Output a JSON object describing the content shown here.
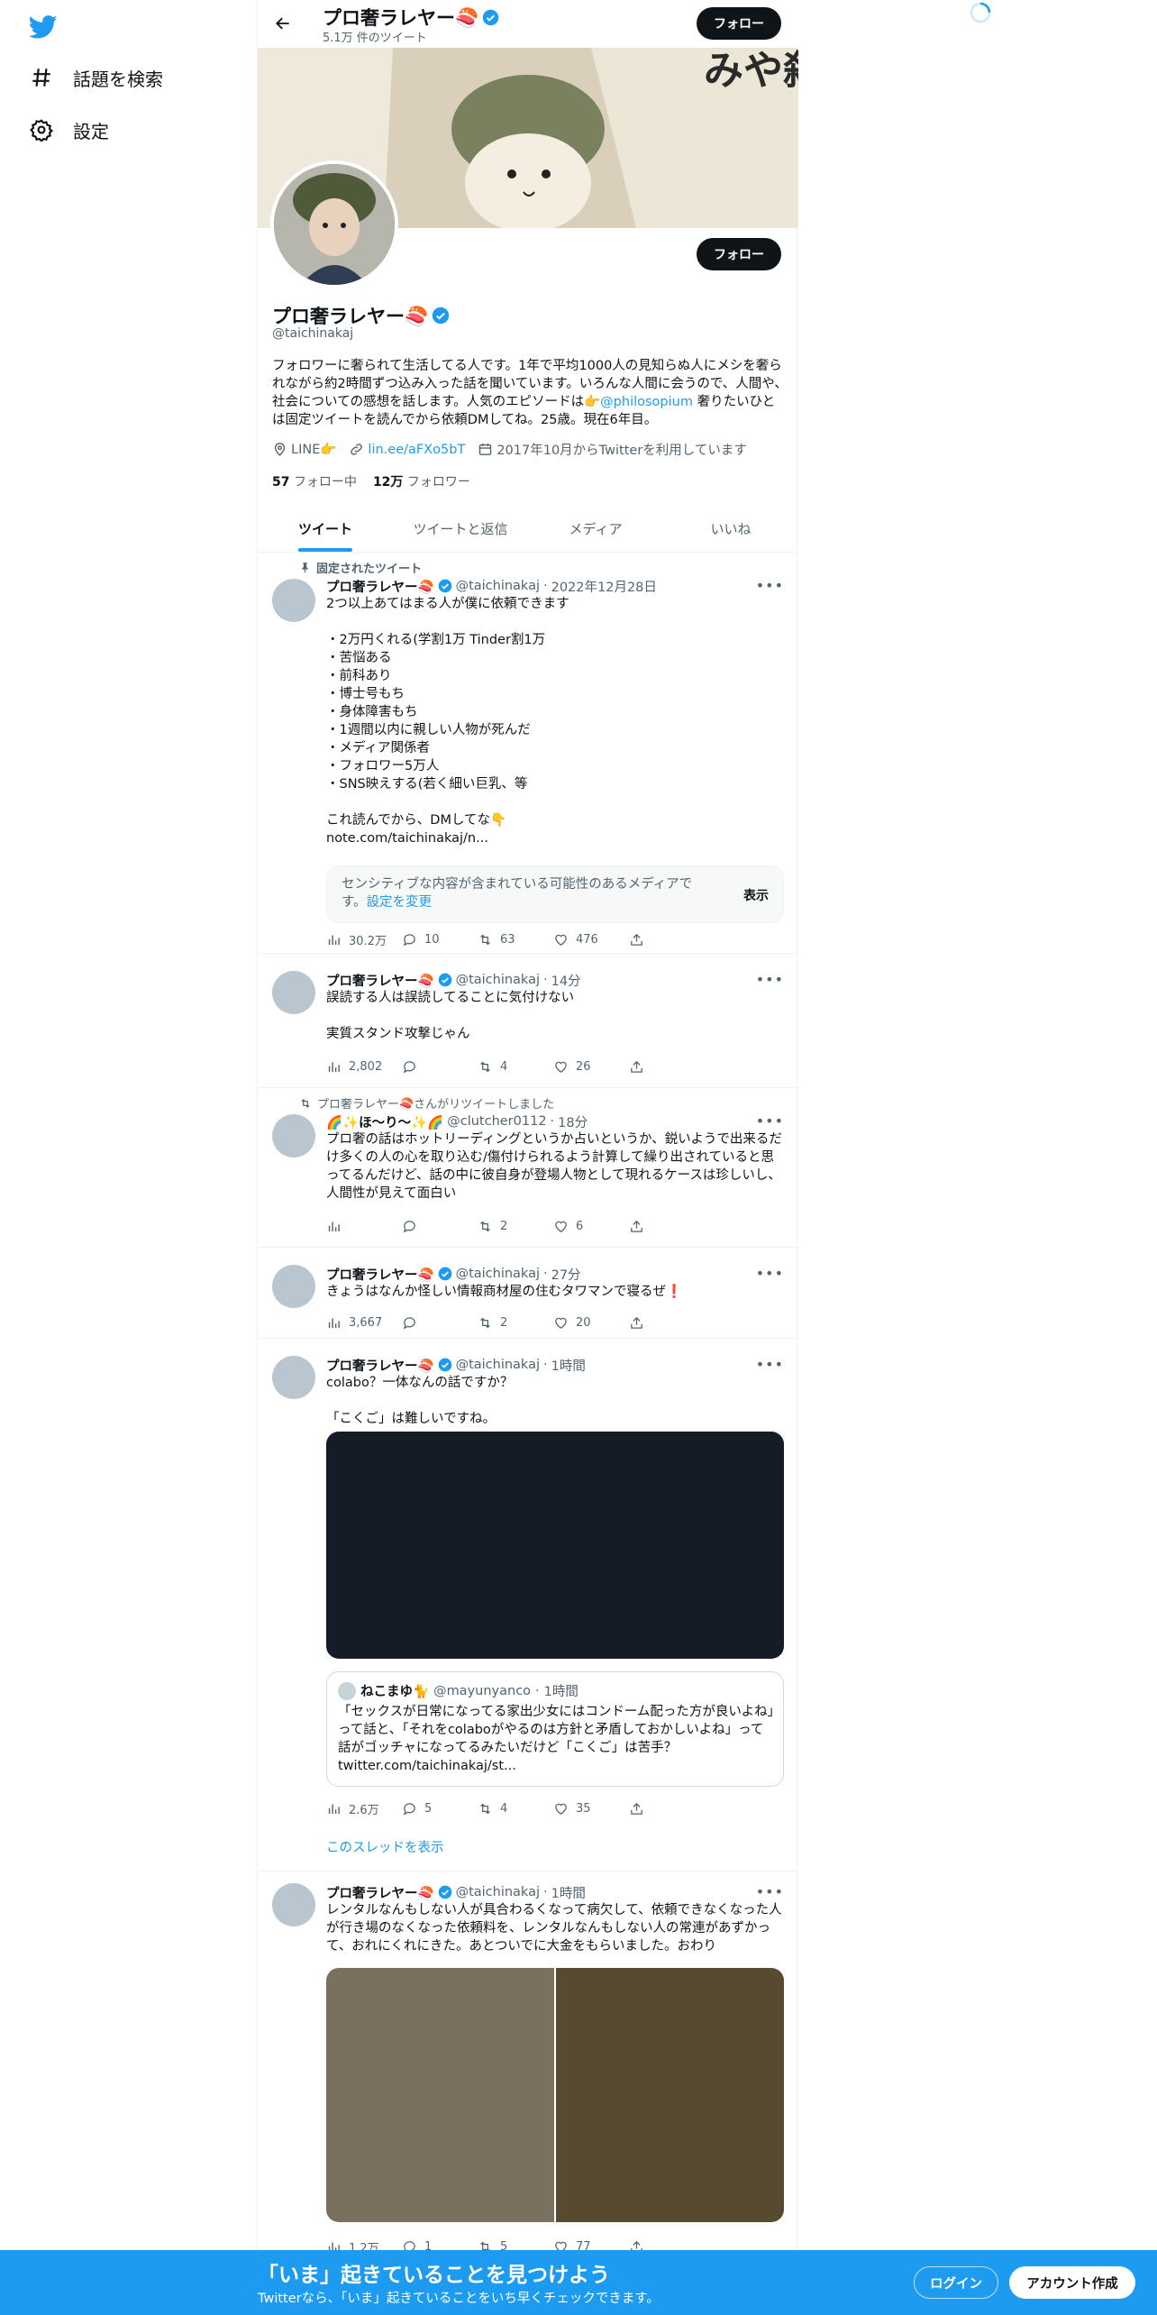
{
  "nav": {
    "explore_label": "話題を検索",
    "settings_label": "設定"
  },
  "header": {
    "name": "プロ奢ラレヤー🍣",
    "tweet_count": "5.1万 件のツイート",
    "follow_label": "フォロー"
  },
  "profile": {
    "name": "プロ奢ラレヤー🍣",
    "handle": "@taichinakaj",
    "follow_label": "フォロー",
    "bio_pre": "フォロワーに奢られて生活してる人です。1年で平均1000人の見知らぬ人にメシを奢られながら約2時間ずつ込み入った話を聞いています。いろんな人間に会うので、人間や、社会についての感想を話します。人気のエピソードは👉",
    "bio_mention": "@philosopium",
    "bio_post": " 奢りたいひとは固定ツイートを読んでから依頼DMしてね。25歳。現在6年目。",
    "location": "LINE👉",
    "link": "lin.ee/aFXo5bT",
    "joined": "2017年10月からTwitterを利用しています",
    "following_count": "57",
    "following_label": "フォロー中",
    "followers_count": "12万",
    "followers_label": "フォロワー"
  },
  "tabs": [
    "ツイート",
    "ツイートと返信",
    "メディア",
    "いいね"
  ],
  "tweets": [
    {
      "social": "固定されたツイート",
      "name": "プロ奢ラレヤー🍣",
      "handle": "@taichinakaj",
      "time": "2022年12月28日",
      "text": "2つ以上あてはまる人が僕に依頼できます\n\n・2万円くれる(学割1万 Tinder割1万\n・苦悩ある\n・前科あり\n・博士号もち\n・身体障害もち\n・1週間以内に親しい人物が死んだ\n・メディア関係者\n・フォロワー5万人\n・SNS映えする(若く細い巨乳、等\n\nこれ読んでから、DMしてな👇",
      "link": "note.com/taichinakaj/n...",
      "sensitive_text": "センシティブな内容が含まれている可能性のあるメディアです。",
      "sensitive_link": "設定を変更",
      "sensitive_show": "表示",
      "views": "30.2万",
      "replies": "10",
      "retweets": "63",
      "likes": "476"
    },
    {
      "name": "プロ奢ラレヤー🍣",
      "handle": "@taichinakaj",
      "time": "14分",
      "text": "誤読する人は誤読してることに気付けない\n\n実質スタンド攻撃じゃん",
      "views": "2,802",
      "replies": "",
      "retweets": "4",
      "likes": "26"
    },
    {
      "social": "プロ奢ラレヤー🍣さんがリツイートしました",
      "name": "🌈✨ほ～り～✨🌈",
      "handle": "@clutcher0112",
      "time": "18分",
      "text": "プロ奢の話はホットリーディングというか占いというか、鋭いようで出来るだけ多くの人の心を取り込む/傷付けられるよう計算して繰り出されていると思ってるんだけど、話の中に彼自身が登場人物として現れるケースは珍しいし、人間性が見えて面白い",
      "views": "",
      "replies": "",
      "retweets": "2",
      "likes": "6"
    },
    {
      "name": "プロ奢ラレヤー🍣",
      "handle": "@taichinakaj",
      "time": "27分",
      "text": "きょうはなんか怪しい情報商材屋の住むタワマンで寝るぜ❗",
      "views": "3,667",
      "replies": "",
      "retweets": "2",
      "likes": "20"
    },
    {
      "name": "プロ奢ラレヤー🍣",
      "handle": "@taichinakaj",
      "time": "1時間",
      "text": "colabo？一体なんの話ですか？\n\n「こくご」は難しいですね。",
      "quote_name": "ねこまゆ🐈",
      "quote_handle": "@mayunyanco",
      "quote_time": "1時間",
      "quote_text": "「セックスが日常になってる家出少女にはコンドーム配った方が良いよね」って話と、「それをcolaboがやるのは方針と矛盾しておかしいよね」って話がゴッチャになってるみたいだけど「こくご」は苦手？",
      "quote_link": "twitter.com/taichinakaj/st...",
      "views": "2.6万",
      "replies": "5",
      "retweets": "4",
      "likes": "35",
      "thread_label": "このスレッドを表示"
    },
    {
      "name": "プロ奢ラレヤー🍣",
      "handle": "@taichinakaj",
      "time": "1時間",
      "text": "レンタルなんもしない人が具合わるくなって病欠して、依頼できなくなった人が行き場のなくなった依頼料を、レンタルなんもしない人の常連があずかって、おれにくれにきた。あとついでに大金をもらいました。おわり",
      "views": "1.2万",
      "replies": "1",
      "retweets": "5",
      "likes": "77"
    }
  ],
  "bottom_bar": {
    "title": "「いま」起きていることを見つけよう",
    "subtitle": "Twitterなら、「いま」起きていることをいち早くチェックできます。",
    "login_label": "ログイン",
    "signup_label": "アカウント作成"
  },
  "colors": {
    "accent": "#1d9bf0",
    "text": "#0f1419",
    "secondary": "#536471"
  }
}
